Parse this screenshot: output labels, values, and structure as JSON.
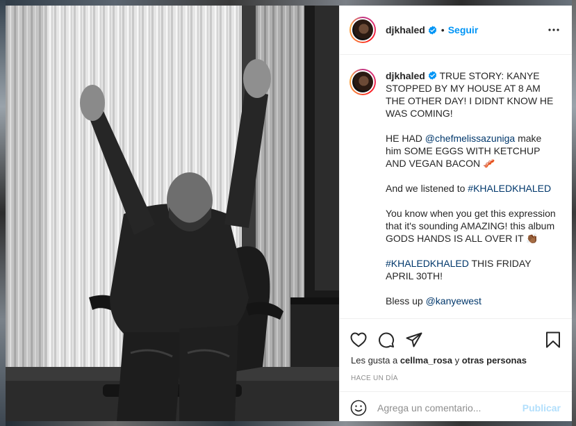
{
  "post": {
    "username": "djkhaled",
    "dot": "•",
    "follow_label": "Seguir",
    "more_icon": "more-horizontal-icon"
  },
  "caption": {
    "username": "djkhaled",
    "p1": "TRUE STORY: KANYE STOPPED BY MY HOUSE AT 8 AM THE OTHER DAY! I DIDNT KNOW HE WAS COMING!",
    "p2_a": "HE HAD ",
    "p2_mention": "@chefmelissazuniga",
    "p2_b": " make him SOME EGGS WITH KETCHUP AND VEGAN BACON 🥓",
    "p3_a": "And we listened to ",
    "p3_tag": "#KHALEDKHALED",
    "p4": "You know when you get this expression that it's sounding AMAZING! this album GODS HANDS IS ALL OVER IT 👏🏾",
    "p5_tag": "#KHALEDKHALED",
    "p5_b": " THIS FRIDAY APRIL 30TH!",
    "p6_a": "Bless up ",
    "p6_mention": "@kanyewest"
  },
  "actions": {
    "likes_prefix": "Les gusta a ",
    "likes_user": "cellma_rosa",
    "likes_mid": " y ",
    "likes_others": "otras personas",
    "timestamp": "HACE UN DÍA",
    "comment_placeholder": "Agrega un comentario...",
    "publish_label": "Publicar"
  },
  "colors": {
    "accent": "#0095f6",
    "link": "#00376b",
    "publish_disabled": "#b2dffc",
    "muted": "#8e8e8e"
  }
}
